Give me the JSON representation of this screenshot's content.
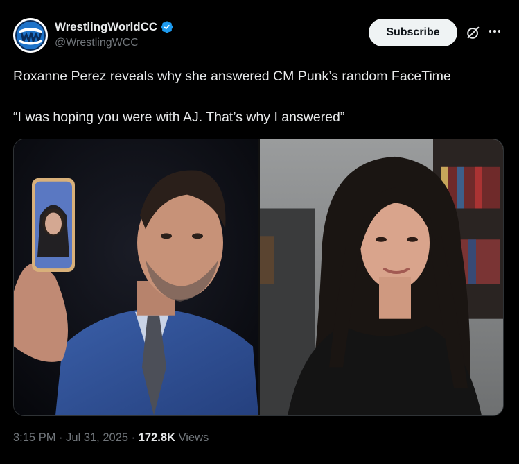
{
  "account": {
    "display_name": "WrestlingWorldCC",
    "handle": "@WrestlingWCC",
    "verified": true,
    "avatar_icon": "globe-logo-icon"
  },
  "actions": {
    "subscribe_label": "Subscribe",
    "grok_icon": "grok-icon",
    "more_icon": "more-dots-icon"
  },
  "tweet": {
    "line1": "Roxanne Perez reveals why she answered CM Punk’s random FaceTime",
    "line2": "“I was hoping you were with AJ. That’s why I answered”"
  },
  "media": {
    "images": [
      {
        "name": "media-image-left"
      },
      {
        "name": "media-image-right"
      }
    ]
  },
  "meta": {
    "time": "3:15 PM",
    "separator": "·",
    "date": "Jul 31, 2025",
    "views_count": "172.8K",
    "views_label": "Views"
  },
  "colors": {
    "background": "#000000",
    "text_primary": "#e7e9ea",
    "text_secondary": "#71767b",
    "verified_blue": "#1d9bf0",
    "border": "#2f3336"
  }
}
